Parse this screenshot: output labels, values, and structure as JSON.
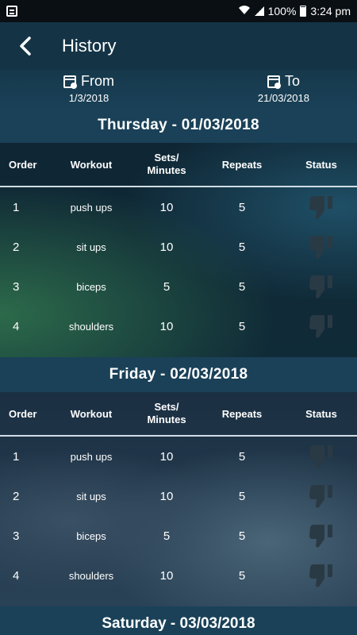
{
  "status_bar": {
    "battery": "100%",
    "time": "3:24 pm"
  },
  "header": {
    "title": "History"
  },
  "range": {
    "from_label": "From",
    "from_value": "1/3/2018",
    "to_label": "To",
    "to_value": "21/03/2018"
  },
  "columns": {
    "order": "Order",
    "workout": "Workout",
    "sets_line1": "Sets/",
    "sets_line2": "Minutes",
    "repeats": "Repeats",
    "status": "Status"
  },
  "days": [
    {
      "title": "Thursday - 01/03/2018",
      "rows": [
        {
          "order": "1",
          "workout": "push ups",
          "sets": "10",
          "repeats": "5",
          "status": "thumbs-down"
        },
        {
          "order": "2",
          "workout": "sit ups",
          "sets": "10",
          "repeats": "5",
          "status": "thumbs-down"
        },
        {
          "order": "3",
          "workout": "biceps",
          "sets": "5",
          "repeats": "5",
          "status": "thumbs-down"
        },
        {
          "order": "4",
          "workout": "shoulders",
          "sets": "10",
          "repeats": "5",
          "status": "thumbs-down"
        }
      ]
    },
    {
      "title": "Friday - 02/03/2018",
      "rows": [
        {
          "order": "1",
          "workout": "push ups",
          "sets": "10",
          "repeats": "5",
          "status": "thumbs-down"
        },
        {
          "order": "2",
          "workout": "sit ups",
          "sets": "10",
          "repeats": "5",
          "status": "thumbs-down"
        },
        {
          "order": "3",
          "workout": "biceps",
          "sets": "5",
          "repeats": "5",
          "status": "thumbs-down"
        },
        {
          "order": "4",
          "workout": "shoulders",
          "sets": "10",
          "repeats": "5",
          "status": "thumbs-down"
        }
      ]
    },
    {
      "title": "Saturday - 03/03/2018",
      "rows": []
    }
  ],
  "icons": {
    "back": "arrow-left-icon",
    "calendar": "calendar-icon",
    "status": "thumbs-down-icon"
  },
  "colors": {
    "header_bg": "#143446",
    "day_bg": "#1a4158",
    "thumb": "#2a3a44"
  }
}
